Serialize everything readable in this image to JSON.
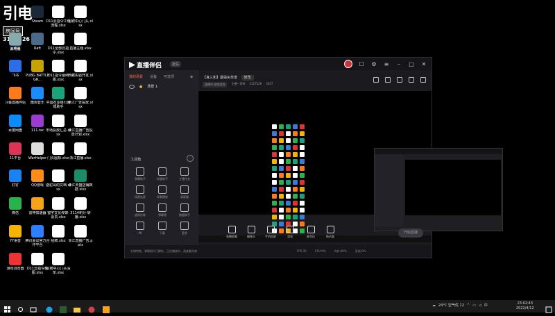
{
  "overlay": {
    "logo_text": "引电",
    "tag": "房间号",
    "room_number": "3127526"
  },
  "desktop_icons": [
    {
      "label": "此电脑",
      "color": "#3a7bd5"
    },
    {
      "label": "回收站",
      "color": "#8aa"
    },
    {
      "label": "飞书",
      "color": "#2b6ee8"
    },
    {
      "label": "斗鱼直播伴侣",
      "color": "#ff7a1a"
    },
    {
      "label": "百度网盘",
      "color": "#0a8cff"
    },
    {
      "label": "11平台",
      "color": "#d35"
    },
    {
      "label": "钉钉",
      "color": "#1b82f0"
    },
    {
      "label": "微信",
      "color": "#2bb34b"
    },
    {
      "label": "YY语音",
      "color": "#f5b400"
    },
    {
      "label": "游戏浏览器",
      "color": "#e33"
    },
    {
      "label": "Steam",
      "color": "#1b2838"
    },
    {
      "label": "Raft",
      "color": "#4a6b8a"
    },
    {
      "label": "PUBG BATTLEGR...",
      "color": "#c8a200"
    },
    {
      "label": "酷狗音乐",
      "color": "#1a8cff"
    },
    {
      "label": "111.rar",
      "color": "#9b3bd1"
    },
    {
      "label": "WarHelper",
      "color": "#ddd"
    },
    {
      "label": "QQ游戏",
      "color": "#ff8c1a"
    },
    {
      "label": "雷神加速器",
      "color": "#f7a21b"
    },
    {
      "label": "腾讯会议官方合作平台",
      "color": "#2c7fff"
    },
    {
      "label": "D11云指令截图.xlsx",
      "color": "#ffffff"
    },
    {
      "label": "D11云指令工作流程.xlsx",
      "color": "#ffffff"
    },
    {
      "label": "D11全部云指令.xlsx",
      "color": "#ffffff"
    },
    {
      "label": "D11指令最终版.xlsx",
      "color": "#ffffff"
    },
    {
      "label": "中国农业银行网银助手",
      "color": "#1aa37a"
    },
    {
      "label": "市场投放汇总.xlsx",
      "color": "#ffffff"
    },
    {
      "label": "门头图标.xlsx",
      "color": "#ffffff"
    },
    {
      "label": "骆驼哥的文档.xlsx",
      "color": "#ffffff"
    },
    {
      "label": "蜀宇文化传媒-会员.xlsx",
      "color": "#ffffff"
    },
    {
      "label": "招聘.xlsx",
      "color": "#ffffff"
    },
    {
      "label": "招聘中心门头清单.xlsx",
      "color": "#ffffff"
    },
    {
      "label": "招聘中心门头.xlsx",
      "color": "#ffffff"
    },
    {
      "label": "直播主题.xlsx",
      "color": "#ffffff"
    },
    {
      "label": "西藏实验开发.xlsx",
      "color": "#ffffff"
    },
    {
      "label": "浙江广告投放.xlsx",
      "color": "#ffffff"
    },
    {
      "label": "浙江直播广告投放计划.xlsx",
      "color": "#ffffff"
    },
    {
      "label": "浙江直播.xlsx",
      "color": "#ffffff"
    },
    {
      "label": "浙江天猫店铺数据.xlsx",
      "color": "#1a8c6a"
    },
    {
      "label": "3114积分-转播.xlsx",
      "color": "#ffffff"
    },
    {
      "label": "浙江直播广告.pptx",
      "color": "#ffffff"
    }
  ],
  "app": {
    "logo": "直播伴侣",
    "version": "抢先",
    "left_tabs": [
      "我的场景",
      "设备",
      "可选项"
    ],
    "scene_name": "场景 1",
    "tools_title": "工具箱",
    "tools": [
      {
        "label": "弹幕助手"
      },
      {
        "label": "房管助手"
      },
      {
        "label": "主播任务"
      },
      {
        "label": "投屏连麦"
      },
      {
        "label": "伴奏播放"
      },
      {
        "label": "录屏器"
      },
      {
        "label": "虚拟形象"
      },
      {
        "label": "弹幕墙"
      },
      {
        "label": "数据助手"
      },
      {
        "label": "PK"
      },
      {
        "label": "下载"
      },
      {
        "label": "更多"
      }
    ],
    "room_title": "【真三和】最强买单谱",
    "room_title_btn": "修改",
    "room_tag": "直播中-游戏综合",
    "room_host": "主播一声称",
    "room_id": "3127526",
    "room_heat": "3057",
    "actions": [
      {
        "label": "直播屏幕"
      },
      {
        "label": "摄像头"
      },
      {
        "label": "手机投屏"
      },
      {
        "label": "游戏"
      },
      {
        "label": "麦克风"
      },
      {
        "label": "扬声器"
      }
    ],
    "go_live": "开始直播",
    "status_msg": "礼物特效、弹幕图片已解析，正在播放中，请查看礼物",
    "stats": [
      "FPS:30",
      "CPU:9%",
      "内存:46%",
      "丢帧:0%"
    ]
  },
  "taskbar": {
    "weather": "24°C 空气优 12",
    "time": "23:02:43",
    "date": "2022/4/12"
  }
}
